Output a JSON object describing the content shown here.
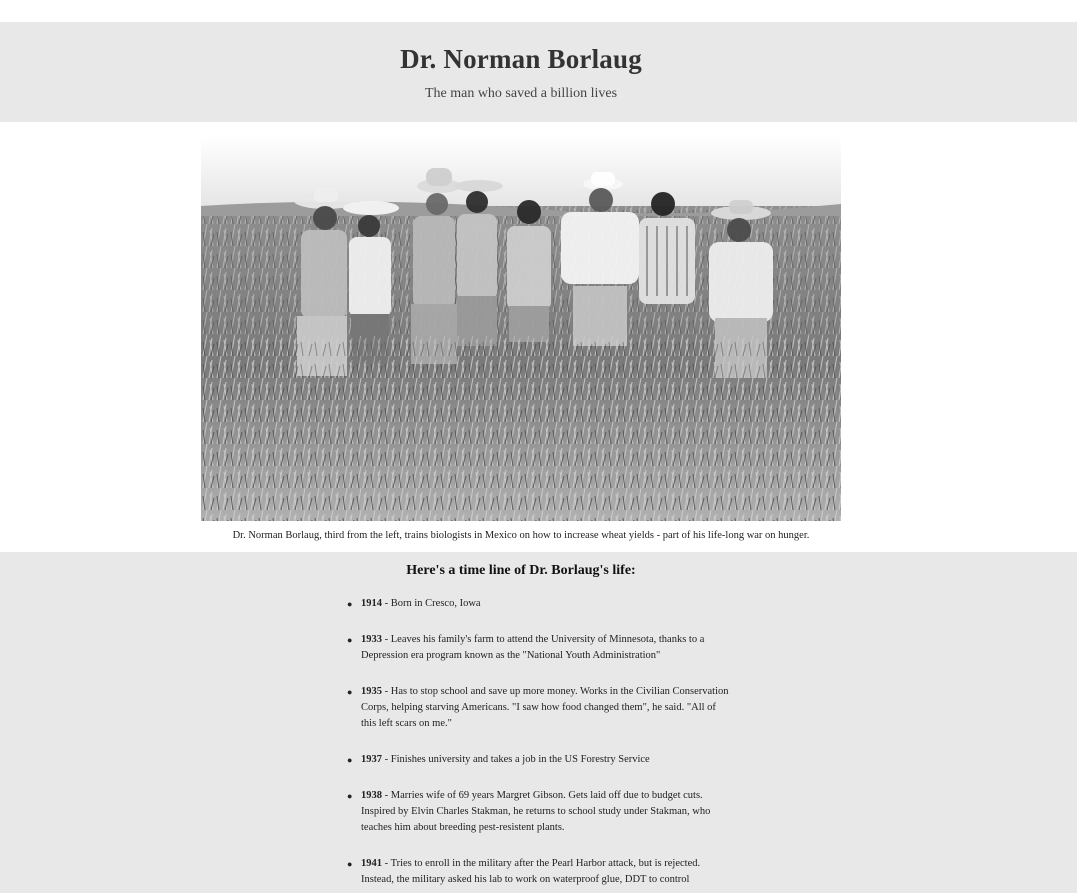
{
  "header": {
    "title": "Dr. Norman Borlaug",
    "tagline": "The man who saved a billion lives"
  },
  "photo": {
    "caption": "Dr. Norman Borlaug, third from the left, trains biologists in Mexico on how to increase wheat yields - part of his life-long war on hunger."
  },
  "timeline": {
    "heading": "Here's a time line of Dr. Borlaug's life:",
    "items": [
      {
        "year": "1914",
        "sep": " - ",
        "text": "Born in Cresco, Iowa"
      },
      {
        "year": "1933",
        "sep": " - ",
        "text": "Leaves his family's farm to attend the University of Minnesota, thanks to a Depression era program known as the \"National Youth Administration\""
      },
      {
        "year": "1935",
        "sep": " - ",
        "text": "Has to stop school and save up more money. Works in the Civilian Conservation Corps, helping starving Americans. \"I saw how food changed them\", he said. \"All of this left scars on me.\""
      },
      {
        "year": "1937",
        "sep": " - ",
        "text": "Finishes university and takes a job in the US Forestry Service"
      },
      {
        "year": "1938",
        "sep": " - ",
        "text": "Marries wife of 69 years Margret Gibson. Gets laid off due to budget cuts. Inspired by Elvin Charles Stakman, he returns to school study under Stakman, who teaches him about breeding pest-resistent plants."
      },
      {
        "year": "1941",
        "sep": " - ",
        "text": "Tries to enroll in the military after the Pearl Harbor attack, but is rejected. Instead, the military asked his lab to work on waterproof glue, DDT to control"
      }
    ]
  }
}
